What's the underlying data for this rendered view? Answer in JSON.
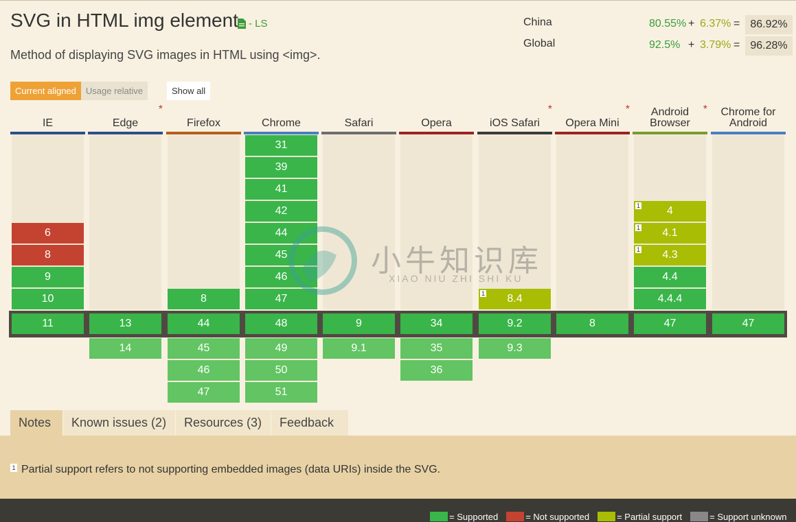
{
  "page": {
    "title": "SVG in HTML img element",
    "spec_status": "- LS",
    "spec_icon": "document-icon",
    "description": "Method of displaying SVG images in HTML using <img>."
  },
  "stats": [
    {
      "region": "China",
      "full": "80.55%",
      "plus": "+",
      "partial": "6.37%",
      "eq": "=",
      "total": "86.92%"
    },
    {
      "region": "Global",
      "full": "92.5%",
      "plus": "+",
      "partial": "3.79%",
      "eq": "=",
      "total": "96.28%"
    }
  ],
  "toggles": {
    "current_aligned": "Current aligned",
    "usage_relative": "Usage relative",
    "show_all": "Show all"
  },
  "browsers": [
    {
      "name": "IE",
      "star": "",
      "color": "#2d4f88",
      "past": [
        {
          "v": "6",
          "s": "n"
        },
        {
          "v": "8",
          "s": "n"
        },
        {
          "v": "9",
          "s": "y"
        },
        {
          "v": "10",
          "s": "y"
        }
      ],
      "current": {
        "v": "11",
        "s": "y"
      },
      "future": []
    },
    {
      "name": "Edge",
      "star": "*",
      "color": "#2d4f88",
      "past": [],
      "current": {
        "v": "13",
        "s": "y"
      },
      "future": [
        {
          "v": "14",
          "s": "y"
        }
      ]
    },
    {
      "name": "Firefox",
      "star": "",
      "color": "#b35f1d",
      "past": [
        {
          "v": "8",
          "s": "y"
        }
      ],
      "current": {
        "v": "44",
        "s": "y"
      },
      "future": [
        {
          "v": "45",
          "s": "y"
        },
        {
          "v": "46",
          "s": "y"
        },
        {
          "v": "47",
          "s": "y"
        }
      ]
    },
    {
      "name": "Chrome",
      "star": "",
      "color": "#4a7fc0",
      "past": [
        {
          "v": "31",
          "s": "y"
        },
        {
          "v": "39",
          "s": "y"
        },
        {
          "v": "41",
          "s": "y"
        },
        {
          "v": "42",
          "s": "y"
        },
        {
          "v": "44",
          "s": "y"
        },
        {
          "v": "45",
          "s": "y"
        },
        {
          "v": "46",
          "s": "y"
        },
        {
          "v": "47",
          "s": "y"
        }
      ],
      "current": {
        "v": "48",
        "s": "y"
      },
      "future": [
        {
          "v": "49",
          "s": "y"
        },
        {
          "v": "50",
          "s": "y"
        },
        {
          "v": "51",
          "s": "y"
        }
      ]
    },
    {
      "name": "Safari",
      "star": "",
      "color": "#6e6e6e",
      "past": [],
      "current": {
        "v": "9",
        "s": "y"
      },
      "future": [
        {
          "v": "9.1",
          "s": "y"
        }
      ]
    },
    {
      "name": "Opera",
      "star": "",
      "color": "#9b2424",
      "past": [],
      "current": {
        "v": "34",
        "s": "y"
      },
      "future": [
        {
          "v": "35",
          "s": "y"
        },
        {
          "v": "36",
          "s": "y"
        }
      ]
    },
    {
      "name": "iOS Safari",
      "star": "*",
      "color": "#3a3a3a",
      "past": [
        {
          "v": "8.4",
          "s": "a",
          "note": "1"
        }
      ],
      "current": {
        "v": "9.2",
        "s": "y"
      },
      "future": [
        {
          "v": "9.3",
          "s": "y"
        }
      ]
    },
    {
      "name": "Opera Mini",
      "star": "*",
      "color": "#9b2424",
      "past": [],
      "current": {
        "v": "8",
        "s": "y"
      },
      "future": []
    },
    {
      "name": "Android Browser",
      "star": "*",
      "color": "#7a9a2e",
      "past": [
        {
          "v": "4",
          "s": "a",
          "note": "1"
        },
        {
          "v": "4.1",
          "s": "a",
          "note": "1"
        },
        {
          "v": "4.3",
          "s": "a",
          "note": "1"
        },
        {
          "v": "4.4",
          "s": "y"
        },
        {
          "v": "4.4.4",
          "s": "y"
        }
      ],
      "current": {
        "v": "47",
        "s": "y"
      },
      "future": []
    },
    {
      "name": "Chrome for Android",
      "star": "",
      "color": "#4a7fc0",
      "past": [],
      "current": {
        "v": "47",
        "s": "y"
      },
      "future": []
    }
  ],
  "tabs": [
    "Notes",
    "Known issues (2)",
    "Resources (3)",
    "Feedback"
  ],
  "notes": [
    {
      "num": "1",
      "text": "Partial support refers to not supporting embedded images (data URIs) inside the SVG."
    }
  ],
  "legend": [
    {
      "label": "= Supported",
      "color": "#39b54a"
    },
    {
      "label": "= Not supported",
      "color": "#c44230"
    },
    {
      "label": "= Partial support",
      "color": "#a8bd04"
    },
    {
      "label": "= Support unknown",
      "color": "#888888"
    }
  ],
  "watermark": {
    "title": "小牛知识库",
    "subtitle": "XIAO NIU ZHI SHI KU"
  }
}
